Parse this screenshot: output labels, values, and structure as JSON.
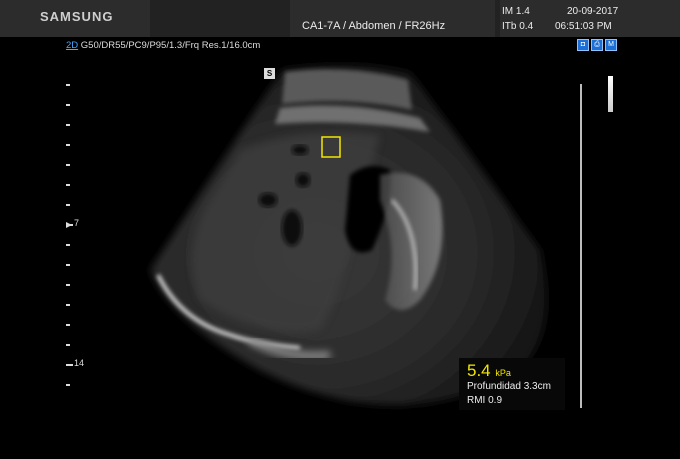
{
  "header": {
    "brand": "SAMSUNG",
    "probe_info": "CA1-7A / Abdomen / FR26Hz",
    "im": "IM  1.4",
    "itb": "ITb  0.4",
    "date": "20-09-2017",
    "time": "06:51:03 PM"
  },
  "params": {
    "mode": "2D",
    "settings": "G50/DR55/PC9/P95/1.3/Frq Res.1/16.0cm"
  },
  "badge": "S",
  "tools": [
    "camera-icon",
    "printer-icon",
    "m-icon"
  ],
  "tool_glyphs": [
    "◘",
    "⎙",
    "M"
  ],
  "depth": {
    "focus": "7",
    "bottom": "14"
  },
  "measurement": {
    "value": "5.4",
    "unit": "kPa",
    "depth_text": "Profundidad 3.3cm",
    "rmi_text": "RMI 0.9"
  },
  "colors": {
    "roi": "#f2e600",
    "accent": "#4aa8ff"
  }
}
